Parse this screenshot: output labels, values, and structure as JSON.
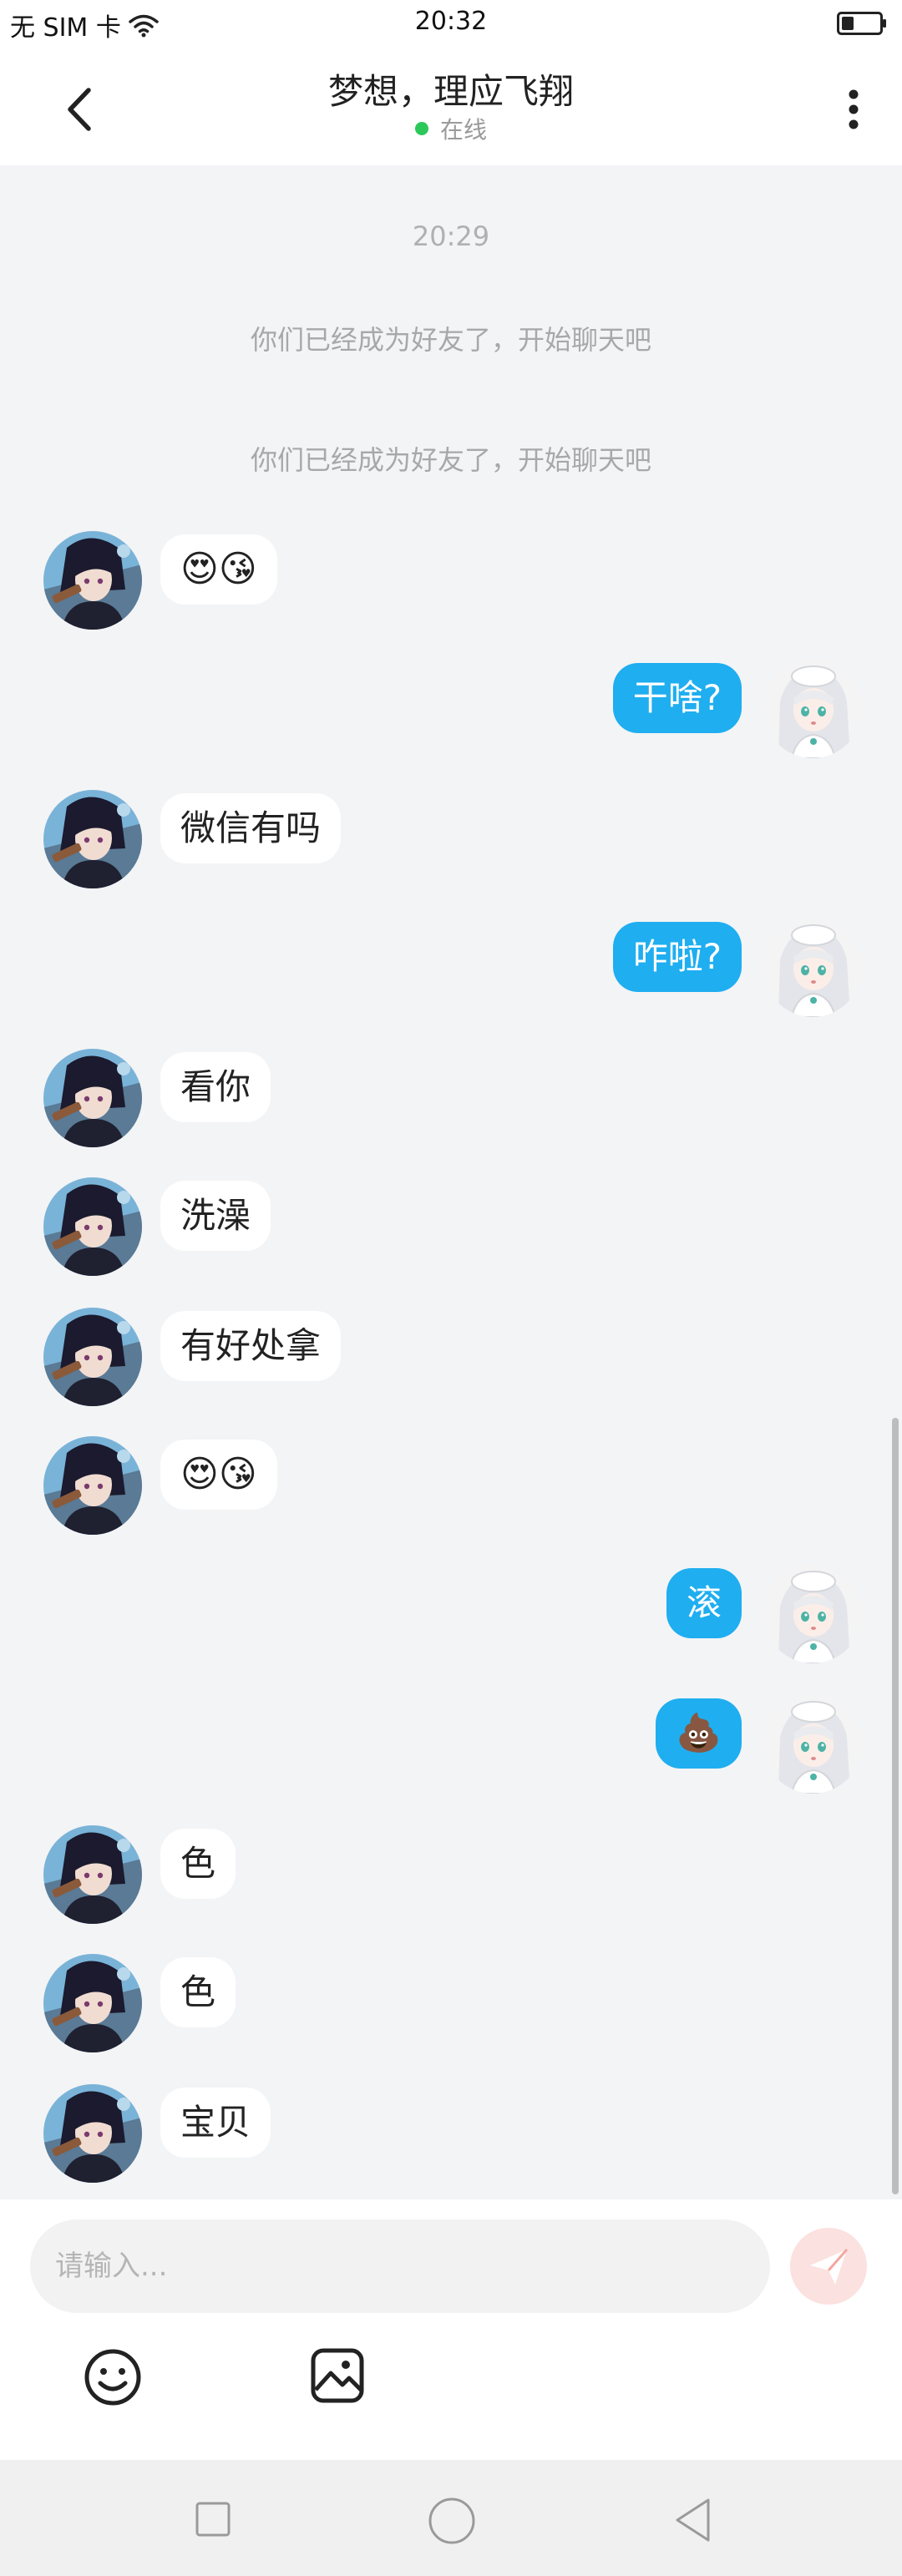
{
  "status_bar": {
    "carrier": "无 SIM 卡",
    "time": "20:32",
    "icons": [
      "wifi-icon",
      "battery-icon"
    ]
  },
  "header": {
    "title": "梦想，理应飞翔",
    "status": "在线",
    "icons": [
      "back-icon",
      "more-icon"
    ],
    "status_color": "#2dc85a"
  },
  "chat": {
    "timestamp": "20:29",
    "system_messages": [
      "你们已经成为好友了，开始聊天吧",
      "你们已经成为好友了，开始聊天吧"
    ],
    "messages": [
      {
        "side": "left",
        "text": "😍😘"
      },
      {
        "side": "right",
        "text": "干啥?"
      },
      {
        "side": "left",
        "text": "微信有吗"
      },
      {
        "side": "right",
        "text": "咋啦?"
      },
      {
        "side": "left",
        "text": "看你"
      },
      {
        "side": "left",
        "text": "洗澡"
      },
      {
        "side": "left",
        "text": "有好处拿"
      },
      {
        "side": "left",
        "text": "😍😘"
      },
      {
        "side": "right",
        "text": "滚"
      },
      {
        "side": "right",
        "text": "💩"
      },
      {
        "side": "left",
        "text": "色"
      },
      {
        "side": "left",
        "text": "色"
      },
      {
        "side": "left",
        "text": "宝贝"
      }
    ],
    "sent_bubble_color": "#1faef0",
    "received_bubble_color": "#ffffff"
  },
  "composer": {
    "placeholder": "请输入...",
    "icons": [
      "send-icon",
      "emoji-icon",
      "image-icon"
    ],
    "send_color": "#f4a6a0"
  },
  "nav_bar": {
    "icons": [
      "recent-apps-icon",
      "home-icon",
      "back-nav-icon"
    ]
  }
}
